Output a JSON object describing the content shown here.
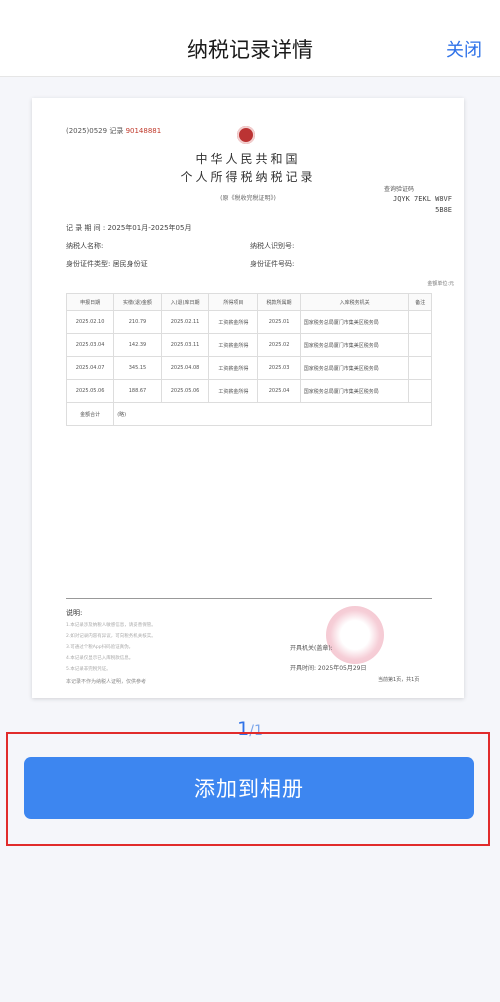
{
  "header": {
    "title": "纳税记录详情",
    "close_label": "关闭"
  },
  "document": {
    "ref_prefix": "(2025)0529",
    "ref_mid": "记录",
    "ref_number": "90148881",
    "title_line1": "中华人民共和国",
    "title_line2": "个人所得税纳税记录",
    "subtitle": "(原《税收完税证明》)",
    "verify_label": "查询验证码",
    "verify_code_line1": "JQYK 7EKL W8VF",
    "verify_code_line2": "5B8E",
    "record_period": "记 录 期 间 : 2025年01月-2025年05月",
    "taxpayer_name": "纳税人名称:",
    "taxpayer_id": "纳税人识别号:",
    "id_type": "身份证件类型: 居民身份证",
    "id_number": "身份证件号码:",
    "unit_label": "金额单位:元",
    "table": {
      "headers": [
        "申报日期",
        "实缴(退)金额",
        "入(退)库日期",
        "所得项目",
        "税款所属期",
        "入库税务机关",
        "备注"
      ],
      "rows": [
        [
          "2025.02.10",
          "210.79",
          "2025.02.11",
          "工资薪金所得",
          "2025.01",
          "国家税务总局厦门市集美区税务局",
          ""
        ],
        [
          "2025.03.04",
          "142.39",
          "2025.03.11",
          "工资薪金所得",
          "2025.02",
          "国家税务总局厦门市集美区税务局",
          ""
        ],
        [
          "2025.04.07",
          "345.15",
          "2025.04.08",
          "工资薪金所得",
          "2025.03",
          "国家税务总局厦门市集美区税务局",
          ""
        ],
        [
          "2025.05.06",
          "188.67",
          "2025.05.06",
          "工资薪金所得",
          "2025.04",
          "国家税务总局厦门市集美区税务局",
          ""
        ]
      ],
      "total_label": "金额合计",
      "total_value": "(略)"
    },
    "notes_title": "说明:",
    "notes": [
      "1.本记录涉及纳税人敏感信息，请妥善保管。",
      "2.如对记录内容有异议，可向税务机关核实。",
      "3.可通过个税App扫码验证真伪。",
      "4.本记录仅显示已入库税款信息。",
      "5.本记录非完税凭证。"
    ],
    "issuer_label": "开具机关(盖章):",
    "issue_date": "开具时间: 2025年05月29日",
    "page_count": "当前第1页，共1页",
    "footer_note": "本记录不作为纳税人证明，仅供参考"
  },
  "pager": {
    "current": "1",
    "total": "/1"
  },
  "action": {
    "add_label": "添加到相册"
  }
}
